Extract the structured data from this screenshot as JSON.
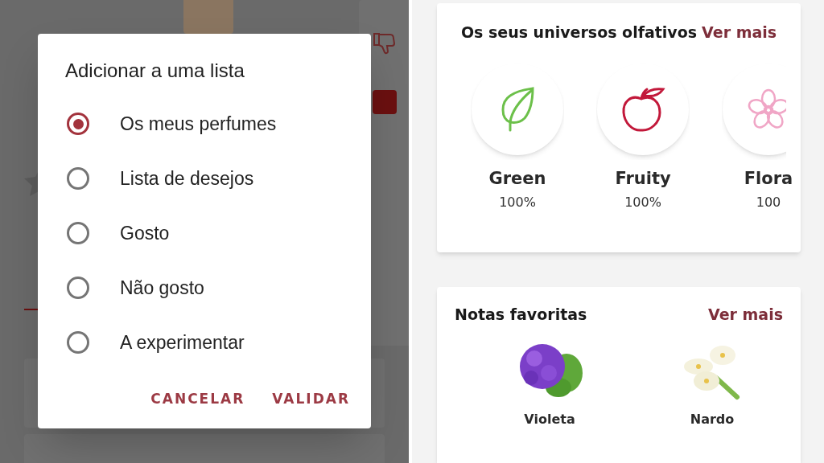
{
  "dialog": {
    "title": "Adicionar a uma lista",
    "options": [
      {
        "label": "Os meus perfumes",
        "selected": true
      },
      {
        "label": "Lista de desejos",
        "selected": false
      },
      {
        "label": "Gosto",
        "selected": false
      },
      {
        "label": "Não gosto",
        "selected": false
      },
      {
        "label": "A experimentar",
        "selected": false
      }
    ],
    "buttons": [
      "CANCELAR",
      "VALIDAR"
    ]
  },
  "universes": {
    "title": "Os seus universos olfativos",
    "link": "Ver mais",
    "items": [
      {
        "kind": "leaf",
        "name": "Green",
        "share": "100%"
      },
      {
        "kind": "fruit",
        "name": "Fruity",
        "share": "100%"
      },
      {
        "kind": "flower",
        "name": "Flora",
        "share": "100"
      }
    ]
  },
  "notes": {
    "title": "Notas favoritas",
    "link": "Ver mais",
    "items": [
      {
        "kind": "violet",
        "name": "Violeta"
      },
      {
        "kind": "tuberose",
        "name": "Nardo"
      }
    ]
  }
}
